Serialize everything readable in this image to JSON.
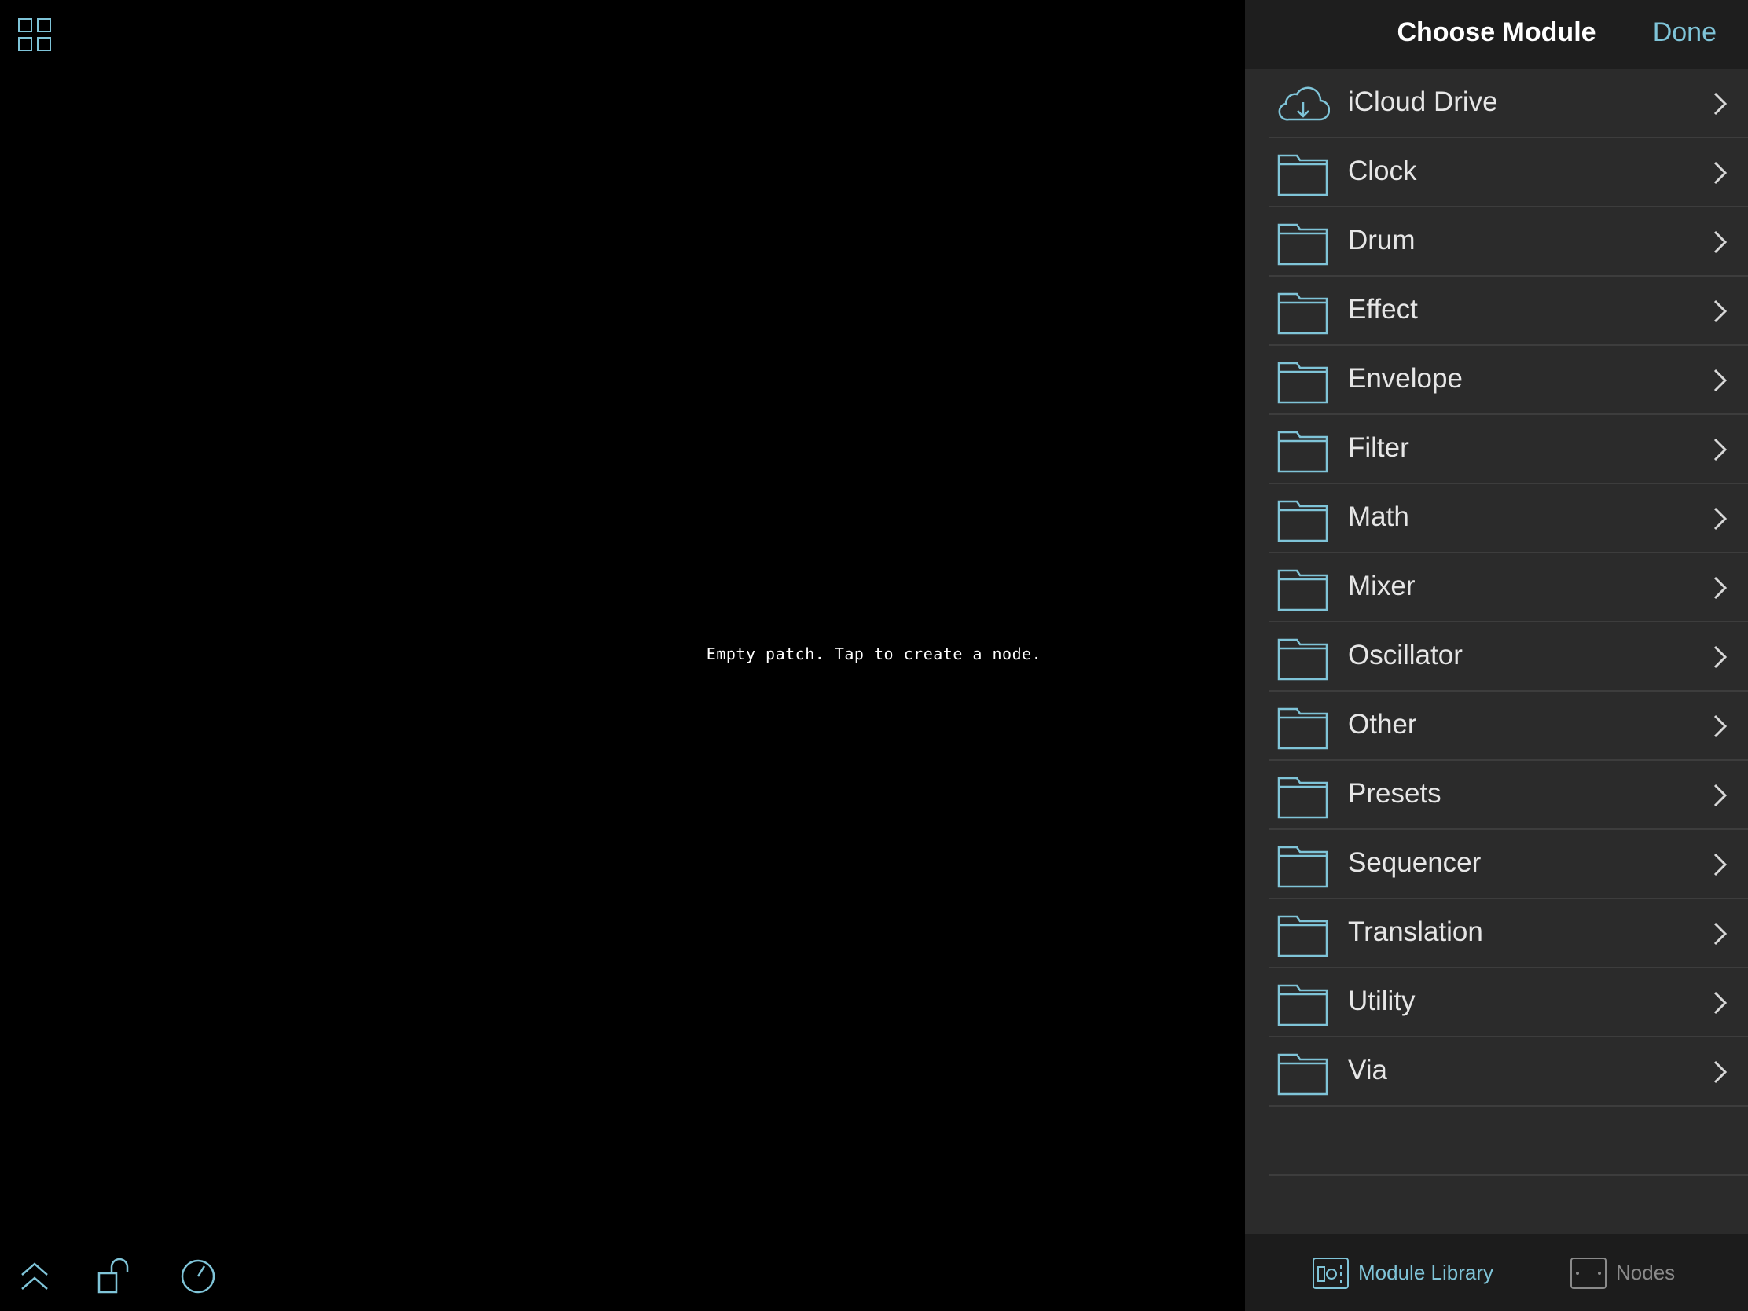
{
  "colors": {
    "accent": "#7fc4d8",
    "inactive": "#8a8a8a",
    "panel_bg": "#2b2b2b",
    "header_bg": "#1e1e1e",
    "separator": "#3d3d3d"
  },
  "canvas": {
    "empty_message": "Empty patch. Tap to create a node.",
    "top_left_icon": "grid-icon",
    "bottom_tools": [
      "chevron-up-double-icon",
      "unlock-icon",
      "clock-icon"
    ]
  },
  "panel": {
    "title": "Choose Module",
    "done_label": "Done",
    "items": [
      {
        "label": "iCloud Drive",
        "icon": "cloud-download-icon"
      },
      {
        "label": "Clock",
        "icon": "folder-icon"
      },
      {
        "label": "Drum",
        "icon": "folder-icon"
      },
      {
        "label": "Effect",
        "icon": "folder-icon"
      },
      {
        "label": "Envelope",
        "icon": "folder-icon"
      },
      {
        "label": "Filter",
        "icon": "folder-icon"
      },
      {
        "label": "Math",
        "icon": "folder-icon"
      },
      {
        "label": "Mixer",
        "icon": "folder-icon"
      },
      {
        "label": "Oscillator",
        "icon": "folder-icon"
      },
      {
        "label": "Other",
        "icon": "folder-icon"
      },
      {
        "label": "Presets",
        "icon": "folder-icon"
      },
      {
        "label": "Sequencer",
        "icon": "folder-icon"
      },
      {
        "label": "Translation",
        "icon": "folder-icon"
      },
      {
        "label": "Utility",
        "icon": "folder-icon"
      },
      {
        "label": "Via",
        "icon": "folder-icon"
      }
    ]
  },
  "tabbar": {
    "tabs": [
      {
        "label": "Module Library",
        "icon": "module-library-icon",
        "active": true
      },
      {
        "label": "Nodes",
        "icon": "nodes-icon",
        "active": false
      }
    ]
  }
}
